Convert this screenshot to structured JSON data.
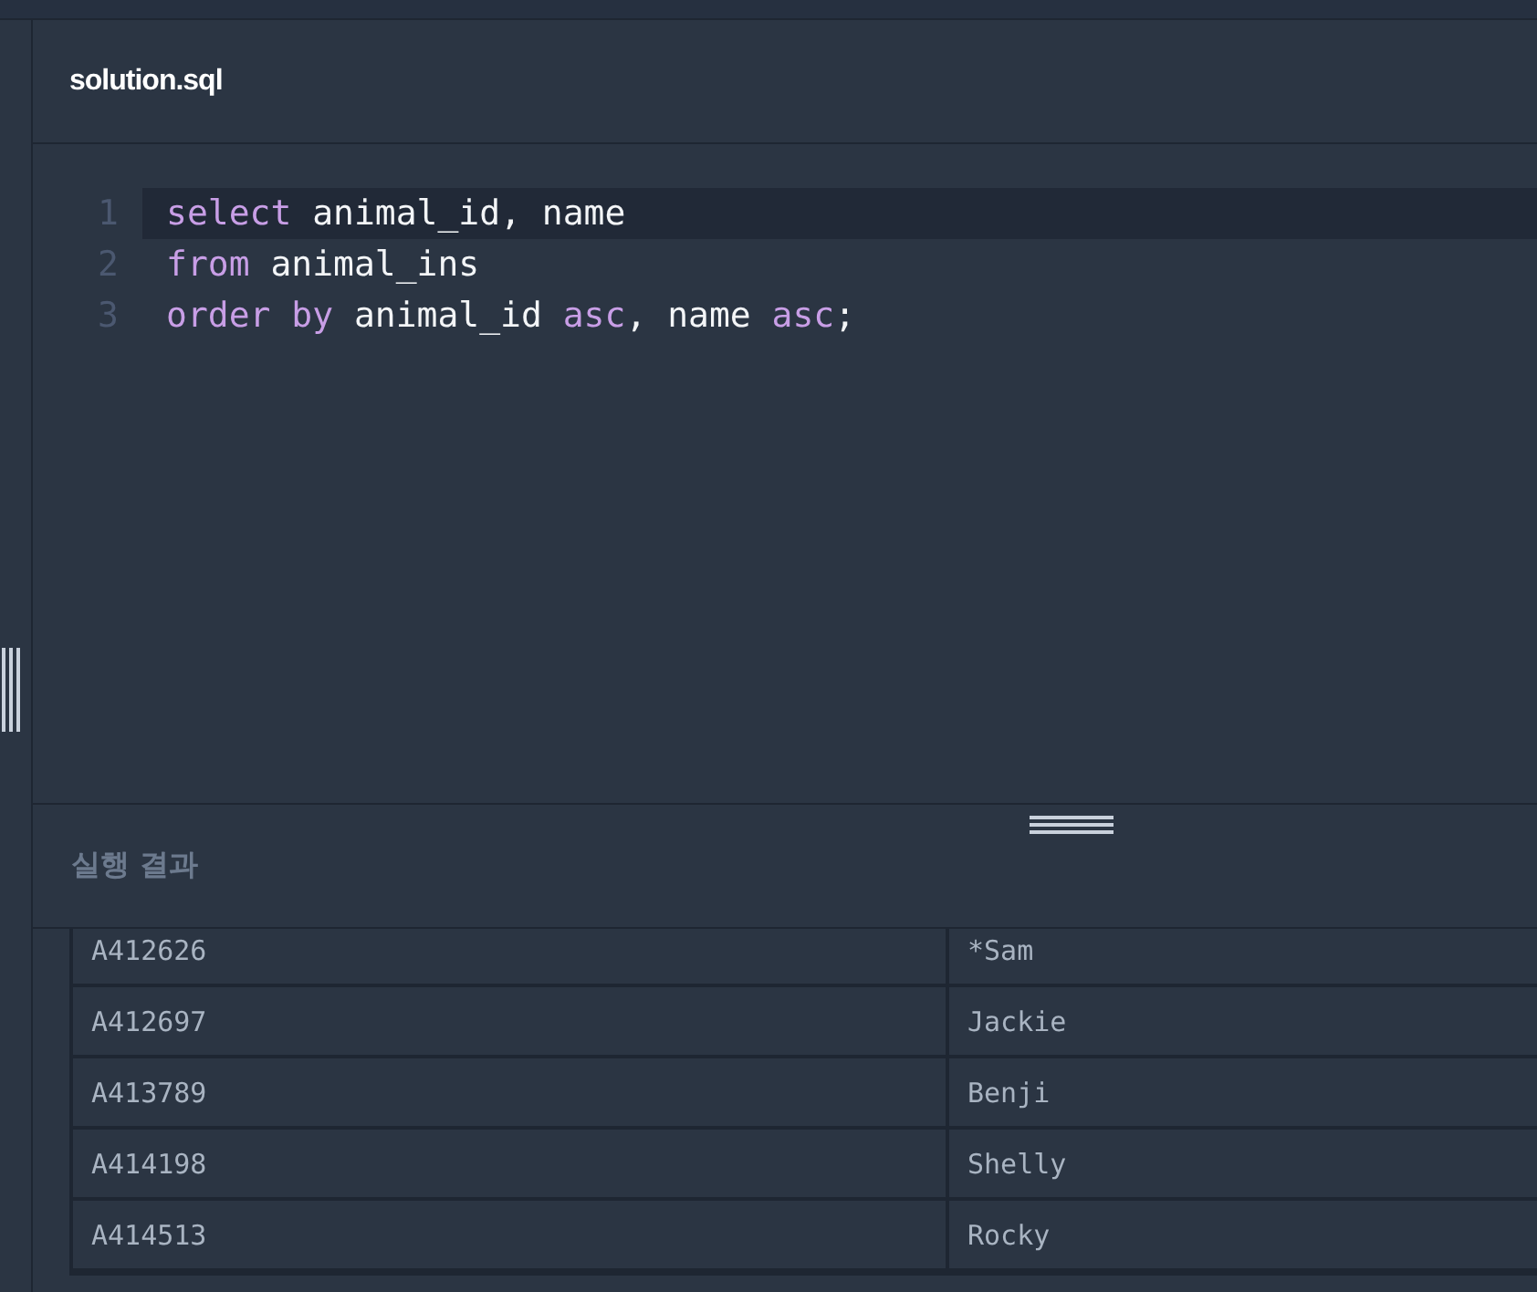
{
  "editor": {
    "filename": "solution.sql",
    "lines": [
      {
        "number": "1",
        "active": true,
        "tokens": [
          {
            "kind": "kw",
            "text": "select"
          },
          {
            "kind": "id",
            "text": " animal_id, name"
          }
        ]
      },
      {
        "number": "2",
        "active": false,
        "tokens": [
          {
            "kind": "kw",
            "text": "from"
          },
          {
            "kind": "id",
            "text": " animal_ins"
          }
        ]
      },
      {
        "number": "3",
        "active": false,
        "tokens": [
          {
            "kind": "kw",
            "text": "order by"
          },
          {
            "kind": "id",
            "text": " animal_id "
          },
          {
            "kind": "kw",
            "text": "asc"
          },
          {
            "kind": "id",
            "text": ", name "
          },
          {
            "kind": "kw",
            "text": "asc"
          },
          {
            "kind": "id",
            "text": ";"
          }
        ]
      }
    ]
  },
  "results": {
    "title": "실행 결과",
    "rows": [
      [
        "A412626",
        "*Sam"
      ],
      [
        "A412697",
        "Jackie"
      ],
      [
        "A413789",
        "Benji"
      ],
      [
        "A414198",
        "Shelly"
      ],
      [
        "A414513",
        "Rocky"
      ]
    ]
  }
}
